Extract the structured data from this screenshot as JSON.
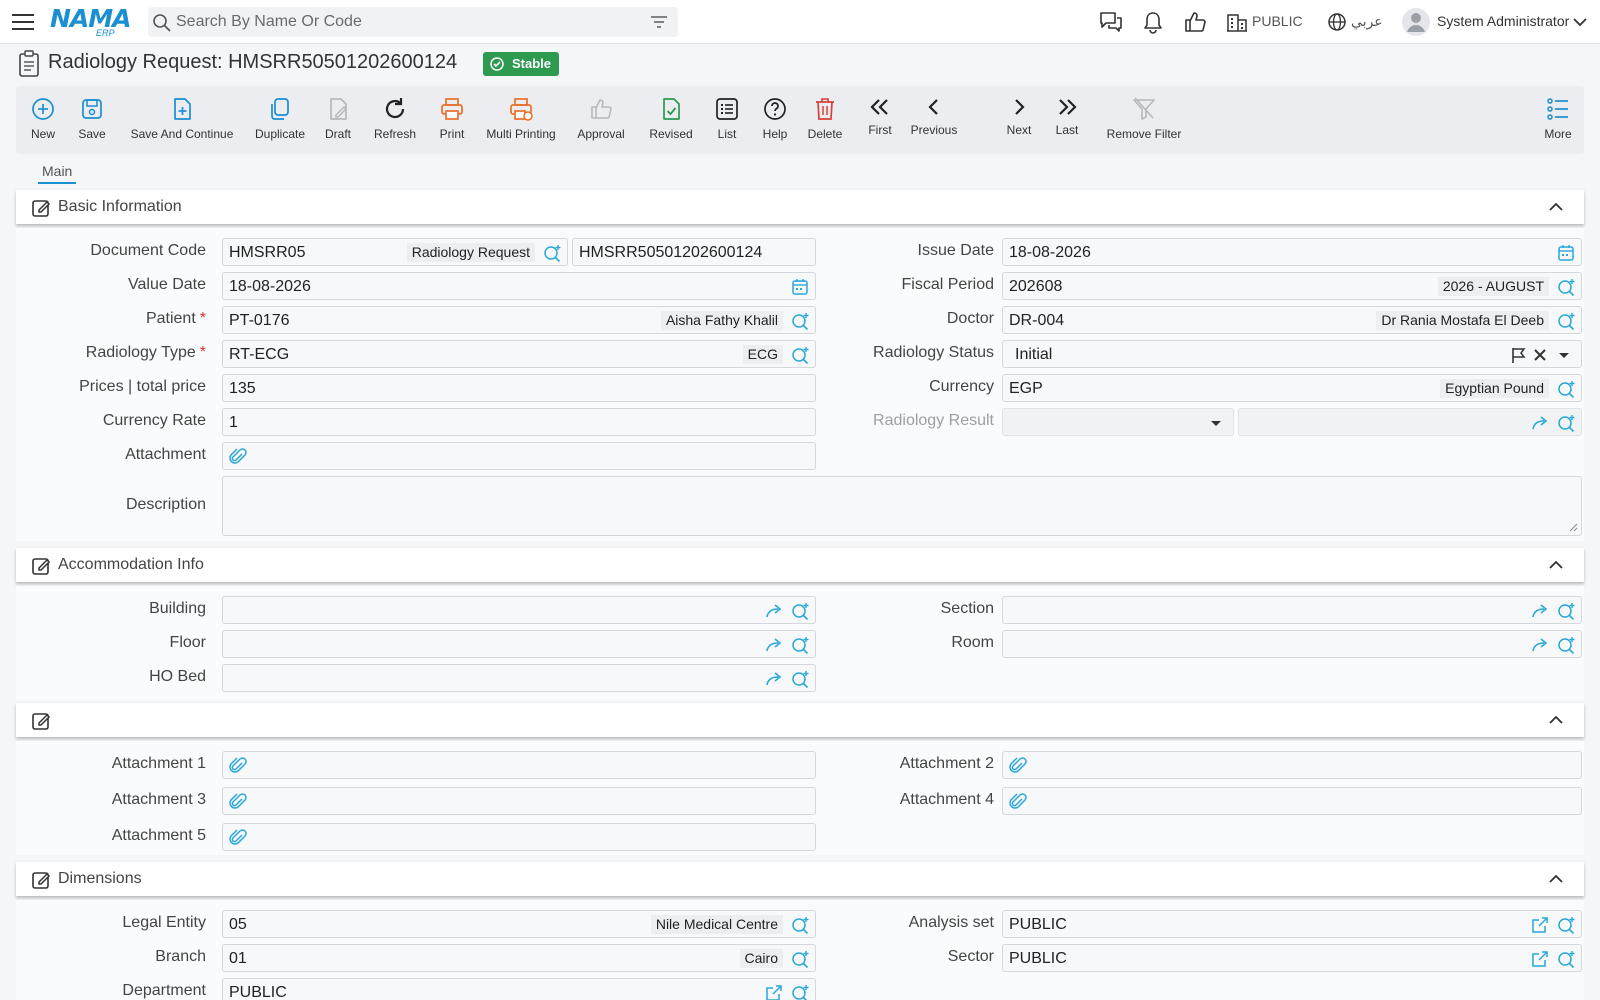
{
  "topbar": {
    "search_placeholder": "Search By Name Or Code",
    "company": "PUBLIC",
    "language": "عربي",
    "user": "System Administrator",
    "logo_text": "NAMA",
    "logo_sub": "ERP",
    "accent_color": "#1a8fd1"
  },
  "page": {
    "title": "Radiology Request: HMSRR50501202600124",
    "status": "Stable",
    "status_color": "#2e9a4f"
  },
  "toolbar": {
    "new": "New",
    "save": "Save",
    "save_continue": "Save And Continue",
    "duplicate": "Duplicate",
    "draft": "Draft",
    "refresh": "Refresh",
    "print": "Print",
    "multi_printing": "Multi Printing",
    "approval": "Approval",
    "revised": "Revised",
    "list": "List",
    "help": "Help",
    "delete": "Delete",
    "first": "First",
    "previous": "Previous",
    "next": "Next",
    "last": "Last",
    "remove_filter": "Remove Filter",
    "more": "More"
  },
  "tabs": {
    "main": "Main"
  },
  "basic": {
    "title": "Basic Information",
    "document_code": {
      "label": "Document Code",
      "code": "HMSRR05",
      "desc": "Radiology Request",
      "number": "HMSRR50501202600124"
    },
    "issue_date": {
      "label": "Issue Date",
      "value": "18-08-2026"
    },
    "value_date": {
      "label": "Value Date",
      "value": "18-08-2026"
    },
    "fiscal_period": {
      "label": "Fiscal Period",
      "value": "202608",
      "desc": "2026 - AUGUST"
    },
    "patient": {
      "label": "Patient",
      "required": "*",
      "value": "PT-0176",
      "desc": "Aisha Fathy Khalil"
    },
    "doctor": {
      "label": "Doctor",
      "value": "DR-004",
      "desc": "Dr Rania Mostafa El Deeb"
    },
    "radiology_type": {
      "label": "Radiology Type",
      "required": "*",
      "value": "RT-ECG",
      "desc": "ECG"
    },
    "radiology_status": {
      "label": "Radiology Status",
      "value": "Initial"
    },
    "total_price": {
      "label": "Prices | total price",
      "value": "135"
    },
    "currency": {
      "label": "Currency",
      "value": "EGP",
      "desc": "Egyptian Pound"
    },
    "currency_rate": {
      "label": "Currency Rate",
      "value": "1"
    },
    "radiology_result": {
      "label": "Radiology Result"
    },
    "attachment": {
      "label": "Attachment"
    },
    "description": {
      "label": "Description"
    }
  },
  "accommodation": {
    "title": "Accommodation Info",
    "building": "Building",
    "section": "Section",
    "floor": "Floor",
    "room": "Room",
    "ho_bed": "HO Bed"
  },
  "attachments": {
    "title": "",
    "a1": "Attachment 1",
    "a2": "Attachment 2",
    "a3": "Attachment 3",
    "a4": "Attachment 4",
    "a5": "Attachment 5"
  },
  "dimensions": {
    "title": "Dimensions",
    "legal_entity": {
      "label": "Legal Entity",
      "value": "05",
      "desc": "Nile Medical Centre"
    },
    "analysis_set": {
      "label": "Analysis set",
      "value": "PUBLIC"
    },
    "branch": {
      "label": "Branch",
      "value": "01",
      "desc": "Cairo"
    },
    "sector": {
      "label": "Sector",
      "value": "PUBLIC"
    },
    "department": {
      "label": "Department",
      "value": "PUBLIC"
    }
  }
}
